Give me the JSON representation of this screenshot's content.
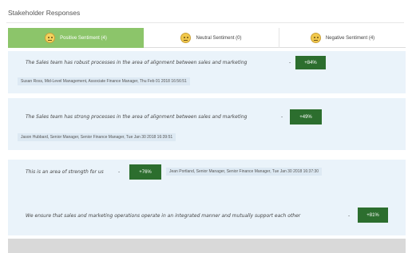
{
  "page": {
    "title": "Stakeholder Responses"
  },
  "tabs": [
    {
      "label": "Positive Sentiment (4)",
      "active": true,
      "icon": "smiley-face-icon"
    },
    {
      "label": "Neutral Sentiment (0)",
      "active": false,
      "icon": "neutral-face-icon"
    },
    {
      "label": "Negative Sentiment (4)",
      "active": false,
      "icon": "neutral-face-icon"
    }
  ],
  "responses": [
    {
      "statement": "The Sales team has robust processes in the area of alignment between sales and marketing",
      "score": "+84%",
      "attribution": "Susan Ross, Mid-Level Management, Associate Finance Manager, Thu Feb 01 2018 16:56:51"
    },
    {
      "statement": "The Sales team has strong processes in the area of alignment between sales and marketing",
      "score": "+49%",
      "attribution": "Jason Hubbard, Senior Manager, Senior Finance Manager, Tue Jan 30 2018 16:39:51"
    },
    {
      "statement": "This is an area of strength for us",
      "score": "+76%",
      "attribution": "Jean Portland, Senior Manager, Senior Finance Manager, Tue Jan 30 2018 16:37:30"
    },
    {
      "statement": "We ensure that sales and marketing operations operate in an integrated manner and mutually support each other",
      "score": "+81%"
    }
  ],
  "colors": {
    "accent": "#8cc56a",
    "score_badge": "#2c6e2e",
    "card_bg": "#eaf3fa"
  }
}
